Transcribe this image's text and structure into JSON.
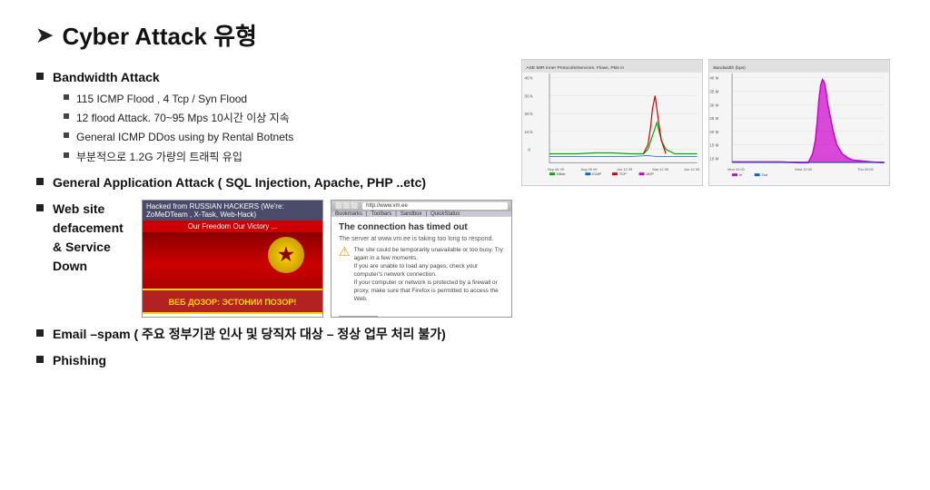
{
  "title": {
    "arrow": "➤",
    "text": "Cyber Attack 유형"
  },
  "sections": {
    "bandwidth": {
      "label": "Bandwidth Attack",
      "sub_items": [
        "115 ICMP Flood , 4 Tcp / Syn Flood",
        "12 flood Attack.  70~95 Mps   10시간 이상 지속",
        "General ICMP DDos  using by Rental Botnets",
        "부분적으로 1.2G 가량의 트래픽 유입"
      ]
    },
    "application": {
      "label": "General Application Attack ( SQL Injection, Apache, PHP ..etc)"
    },
    "webdefacement": {
      "line1": "Web site defacement",
      "line2": "& Service Down"
    },
    "email": {
      "label": "Email –spam ( 주요 정부기관 인사 및 당직자 대상 – 정상 업무 처리 불가)"
    },
    "phishing": {
      "label": "Phishing"
    }
  },
  "defacement_screenshot": {
    "title_bar": "Hacked from RUSSIAN HACKERS (We're: ZoMeDTeam , X-Task, Web-Hack)",
    "banner_text": "Our Freedom    Our Victory ...",
    "cyrillic_text": "ВЕБ ДОЗОР:          ЭСТОНИИ ПОЗОР!"
  },
  "connection_error": {
    "title": "The connection has timed out",
    "subtitle": "The server at www.vm.ee is taking too long to respond.",
    "detail1": "The site could be temporarily unavailable or too busy. Try again in a few moments.",
    "detail2": "If you are unable to load any pages, check your computer's network connection.",
    "detail3": "If your computer or network is protected by a firewall or proxy, make sure that Firefox is permitted to access the Web."
  },
  "chart_left": {
    "title": "ASE MIR Inner Protocols/Services, Flows, Pkts in"
  },
  "chart_right": {
    "title": ""
  }
}
